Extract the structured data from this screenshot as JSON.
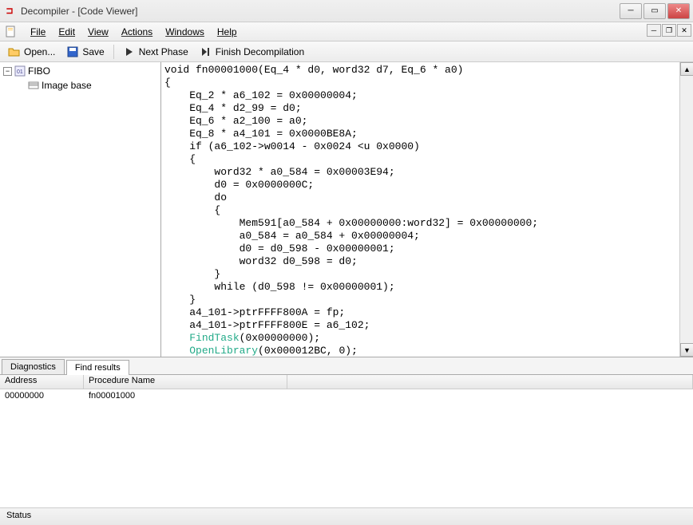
{
  "window": {
    "title": "Decompiler - [Code Viewer]"
  },
  "menu": {
    "file": "File",
    "edit": "Edit",
    "view": "View",
    "actions": "Actions",
    "windows": "Windows",
    "help": "Help"
  },
  "toolbar": {
    "open": "Open...",
    "save": "Save",
    "next_phase": "Next Phase",
    "finish": "Finish Decompilation"
  },
  "tree": {
    "root": "FIBO",
    "child": "Image base"
  },
  "code": {
    "lines": [
      "void fn00001000(Eq_4 * d0, word32 d7, Eq_6 * a0)",
      "{",
      "    Eq_2 * a6_102 = 0x00000004;",
      "    Eq_4 * d2_99 = d0;",
      "    Eq_6 * a2_100 = a0;",
      "    Eq_8 * a4_101 = 0x0000BE8A;",
      "    if (a6_102->w0014 - 0x0024 <u 0x0000)",
      "    {",
      "        word32 * a0_584 = 0x00003E94;",
      "        d0 = 0x0000000C;",
      "        do",
      "        {",
      "            Mem591[a0_584 + 0x00000000:word32] = 0x00000000;",
      "            a0_584 = a0_584 + 0x00000004;",
      "            d0 = d0_598 - 0x00000001;",
      "            word32 d0_598 = d0;",
      "        }",
      "        while (d0_598 != 0x00000001);",
      "    }",
      "    a4_101->ptrFFFF800A = fp;",
      "    a4_101->ptrFFFF800E = a6_102;"
    ],
    "call1_name": "FindTask",
    "call1_args": "(0x00000000);",
    "call2_name": "OpenLibrary",
    "call2_args": "(0x000012BC, 0);"
  },
  "tabs": {
    "diagnostics": "Diagnostics",
    "find_results": "Find results"
  },
  "results": {
    "col_address": "Address",
    "col_procedure": "Procedure Name",
    "rows": [
      {
        "address": "00000000",
        "procedure": "fn00001000"
      }
    ]
  },
  "statusbar": {
    "text": "Status"
  }
}
